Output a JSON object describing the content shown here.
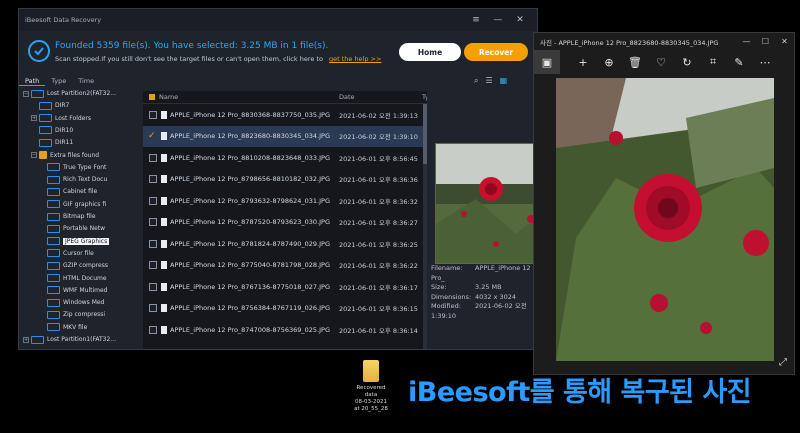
{
  "ibeesoft": {
    "title": "iBeesoft Data Recovery",
    "found": "Founded 5359 file(s). You have selected: 3.25 MB in 1 file(s).",
    "stopped": "Scan stopped.If you still don't see the target files or can't open them, click here to",
    "help_link": "get the help >>",
    "home_button": "Home",
    "recover_button": "Recover",
    "tabs": [
      "Path",
      "Type",
      "Time"
    ],
    "tree": [
      {
        "label": "Lost Partition2(FAT32...",
        "level": 0,
        "expand": "−"
      },
      {
        "label": "DIR7",
        "level": 2
      },
      {
        "label": "Lost Folders",
        "level": 1,
        "expand": "+"
      },
      {
        "label": "DIR10",
        "level": 2
      },
      {
        "label": "DIR11",
        "level": 2
      },
      {
        "label": "Extra files found",
        "level": 1,
        "expand": "−"
      },
      {
        "label": "True Type Font",
        "level": 3
      },
      {
        "label": "Rich Text Docu",
        "level": 3
      },
      {
        "label": "Cabinet file",
        "level": 3
      },
      {
        "label": "GIF graphics fi",
        "level": 3
      },
      {
        "label": "Bitmap file",
        "level": 3
      },
      {
        "label": "Portable Netw",
        "level": 3
      },
      {
        "label": "JPEG Graphics",
        "level": 3,
        "selected": true
      },
      {
        "label": "Cursor file",
        "level": 3
      },
      {
        "label": "GZIP compress",
        "level": 3
      },
      {
        "label": "HTML Docume",
        "level": 3
      },
      {
        "label": "WMF Multimed",
        "level": 3
      },
      {
        "label": "Windows Med",
        "level": 3
      },
      {
        "label": "Zip compressi",
        "level": 3
      },
      {
        "label": "MKV file",
        "level": 3
      },
      {
        "label": "Lost Partition1(FAT32...",
        "level": 0,
        "expand": "+"
      }
    ],
    "columns": {
      "name": "Name",
      "date": "Date",
      "type": "Ty"
    },
    "files": [
      {
        "name": "APPLE_iPhone 12 Pro_8830368-8837750_035.JPG",
        "date": "2021-06-02 오전 1:39:13"
      },
      {
        "name": "APPLE_iPhone 12 Pro_8823680-8830345_034.JPG",
        "date": "2021-06-02 오전 1:39:10",
        "selected": true
      },
      {
        "name": "APPLE_iPhone 12 Pro_8810208-8823648_033.JPG",
        "date": "2021-06-01 오후 8:56:45"
      },
      {
        "name": "APPLE_iPhone 12 Pro_8798656-8810182_032.JPG",
        "date": "2021-06-01 오후 8:36:36"
      },
      {
        "name": "APPLE_iPhone 12 Pro_8793632-8798624_031.JPG",
        "date": "2021-06-01 오후 8:36:32"
      },
      {
        "name": "APPLE_iPhone 12 Pro_8787520-8793623_030.JPG",
        "date": "2021-06-01 오후 8:36:27"
      },
      {
        "name": "APPLE_iPhone 12 Pro_8781824-8787490_029.JPG",
        "date": "2021-06-01 오후 8:36:25"
      },
      {
        "name": "APPLE_iPhone 12 Pro_8775040-8781798_028.JPG",
        "date": "2021-06-01 오후 8:36:22"
      },
      {
        "name": "APPLE_iPhone 12 Pro_8767136-8775018_027.JPG",
        "date": "2021-06-01 오후 8:36:17"
      },
      {
        "name": "APPLE_iPhone 12 Pro_8756384-8767119_026.JPG",
        "date": "2021-06-01 오후 8:36:15"
      },
      {
        "name": "APPLE_iPhone 12 Pro_8747008-8756369_025.JPG",
        "date": "2021-06-01 오후 8:36:14"
      }
    ],
    "meta": [
      {
        "k": "Filename:",
        "v": "APPLE_iPhone 12 Pro_"
      },
      {
        "k": "Size:",
        "v": "3.25 MB"
      },
      {
        "k": "Dimensions:",
        "v": "4032 x 3024"
      },
      {
        "k": "Modified:",
        "v": "2021-06-02 오전 1:39:10"
      }
    ]
  },
  "photos": {
    "title": "사진 - APPLE_iPhone 12 Pro_8823680-8830345_034.JPG",
    "tools": [
      "image-icon",
      "plus-icon",
      "zoom-icon",
      "delete-icon",
      "heart-icon",
      "rotate-icon",
      "crop-icon",
      "edit-icon",
      "more-icon"
    ]
  },
  "desktop": {
    "icon_label": [
      "Recovered",
      "data",
      "08-03-2021",
      "at 20_55_28"
    ]
  },
  "caption": "iBeesoft를 통해 복구된 사진",
  "colors": {
    "accent": "#2fa7f2",
    "recover": "#f6a000",
    "caption": "#2c9bff"
  }
}
